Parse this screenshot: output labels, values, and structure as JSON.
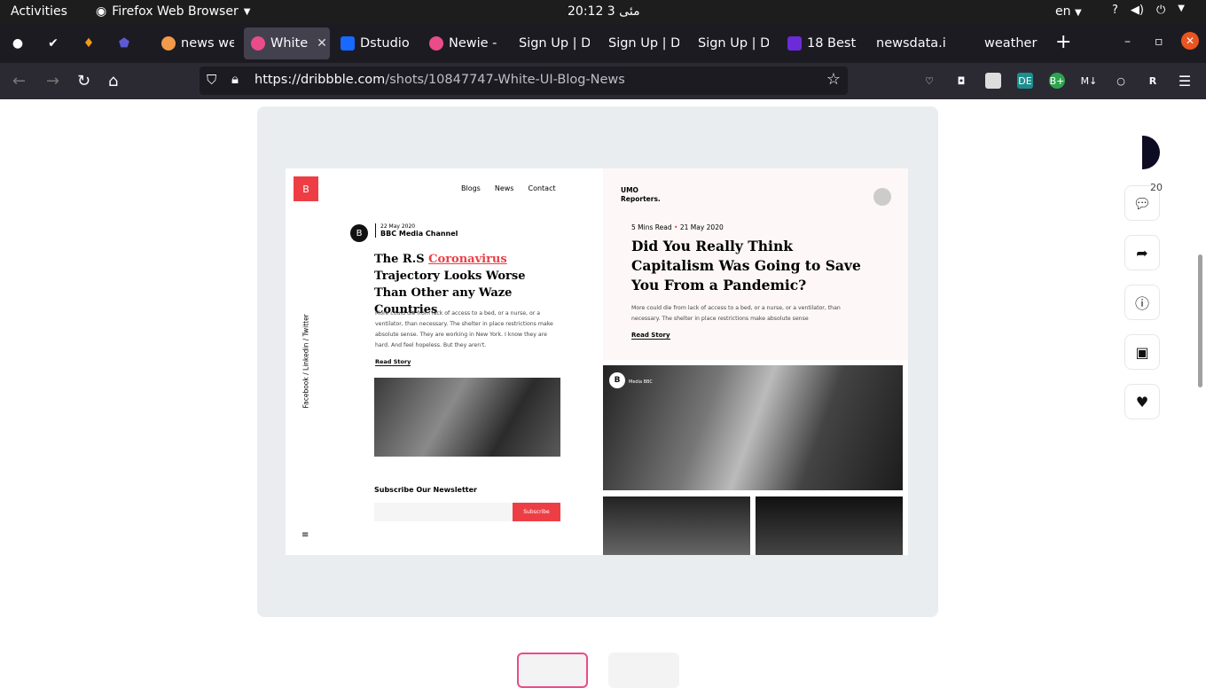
{
  "system": {
    "activities": "Activities",
    "app_name": "Firefox Web Browser",
    "clock": "20:12 مئی 3",
    "lang": "en"
  },
  "tabs": [
    {
      "label": "news we",
      "color": "#f2994a"
    },
    {
      "label": "White",
      "color": "#ea4c89"
    },
    {
      "label": "Dstudio",
      "color": "#1769ff"
    },
    {
      "label": "Newie -",
      "color": "#ea4c89"
    },
    {
      "label": "Sign Up | Dr",
      "color": ""
    },
    {
      "label": "Sign Up | Dr",
      "color": ""
    },
    {
      "label": "Sign Up | Dr",
      "color": ""
    },
    {
      "label": "18 Best",
      "color": "#6b2bd9"
    },
    {
      "label": "newsdata.i",
      "color": ""
    },
    {
      "label": "weather",
      "color": ""
    }
  ],
  "url": {
    "domain": "https://dribbble.com",
    "path": "/shots/10847747-White-UI-Blog-News"
  },
  "mock": {
    "logo": "B",
    "nav": [
      "Blogs",
      "News",
      "Contact"
    ],
    "social": "Facebook / Linkedin / Twitter",
    "date": "22 May 2020",
    "channel": "BBC Media Channel",
    "headline_pre": "The R.S ",
    "headline_link": "Coronavirus",
    "headline_post": " Trajectory Looks Worse Than Other any Waze Countries",
    "body": "More could die from lack of access to a bed, or a nurse, or a ventilator, than necessary. The shelter in place restrictions make absolute sense. They are working in New York. I know they are hard. And feel hopeless. But they aren't.",
    "read": "Read Story",
    "subscribe_title": "Subscribe Our Newsletter",
    "subscribe_btn": "Subscribe",
    "brand_line1": "UMO",
    "brand_line2": "Reporters.",
    "read_time": "5 Mins Read",
    "date2": "21 May 2020",
    "big_headline": "Did You Really Think Capitalism Was Going to Save You From a Pandemic?",
    "body2": "More could die from lack of access to a bed, or a nurse, or a ventilator, than necessary. The shelter in place restrictions make absolute sense",
    "read2": "Read Story",
    "media_label": "Media BBC"
  },
  "actions": {
    "comment_count": "20"
  },
  "colors": {
    "accent": "#ee3e45",
    "bg": "#eaedf0"
  }
}
